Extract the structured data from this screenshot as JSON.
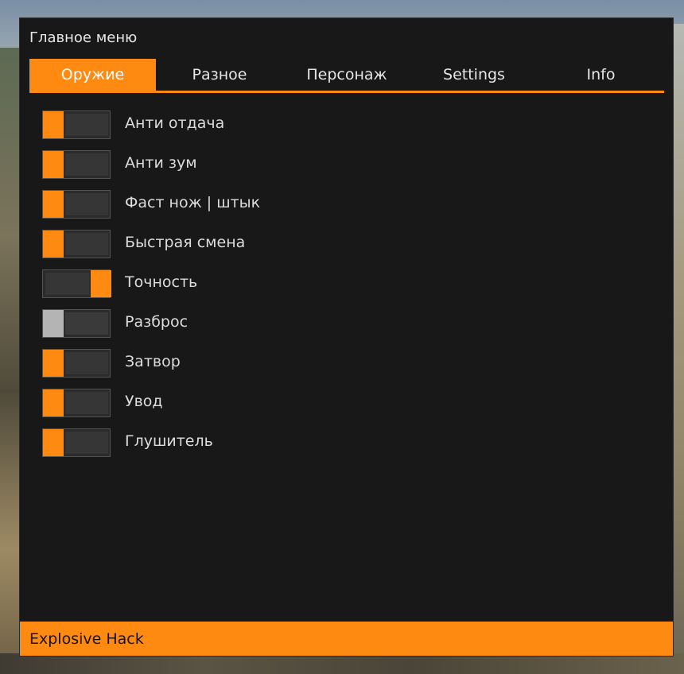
{
  "window": {
    "title": "Главное меню",
    "accent_color": "#ff8a12",
    "background_color": "#191819"
  },
  "tabs": [
    {
      "label": "Оружие",
      "active": true
    },
    {
      "label": "Разное",
      "active": false
    },
    {
      "label": "Персонаж",
      "active": false
    },
    {
      "label": "Settings",
      "active": false
    },
    {
      "label": "Info",
      "active": false
    }
  ],
  "options": [
    {
      "label": "Анти отдача",
      "state": "off"
    },
    {
      "label": "Анти зум",
      "state": "off"
    },
    {
      "label": "Фаст нож | штык",
      "state": "off"
    },
    {
      "label": "Быстрая смена",
      "state": "off"
    },
    {
      "label": "Точность",
      "state": "on"
    },
    {
      "label": "Разброс",
      "state": "disabled"
    },
    {
      "label": "Затвор",
      "state": "off"
    },
    {
      "label": "Увод",
      "state": "off"
    },
    {
      "label": "Глушитель",
      "state": "off"
    }
  ],
  "footer": {
    "text": "Explosive Hack"
  }
}
